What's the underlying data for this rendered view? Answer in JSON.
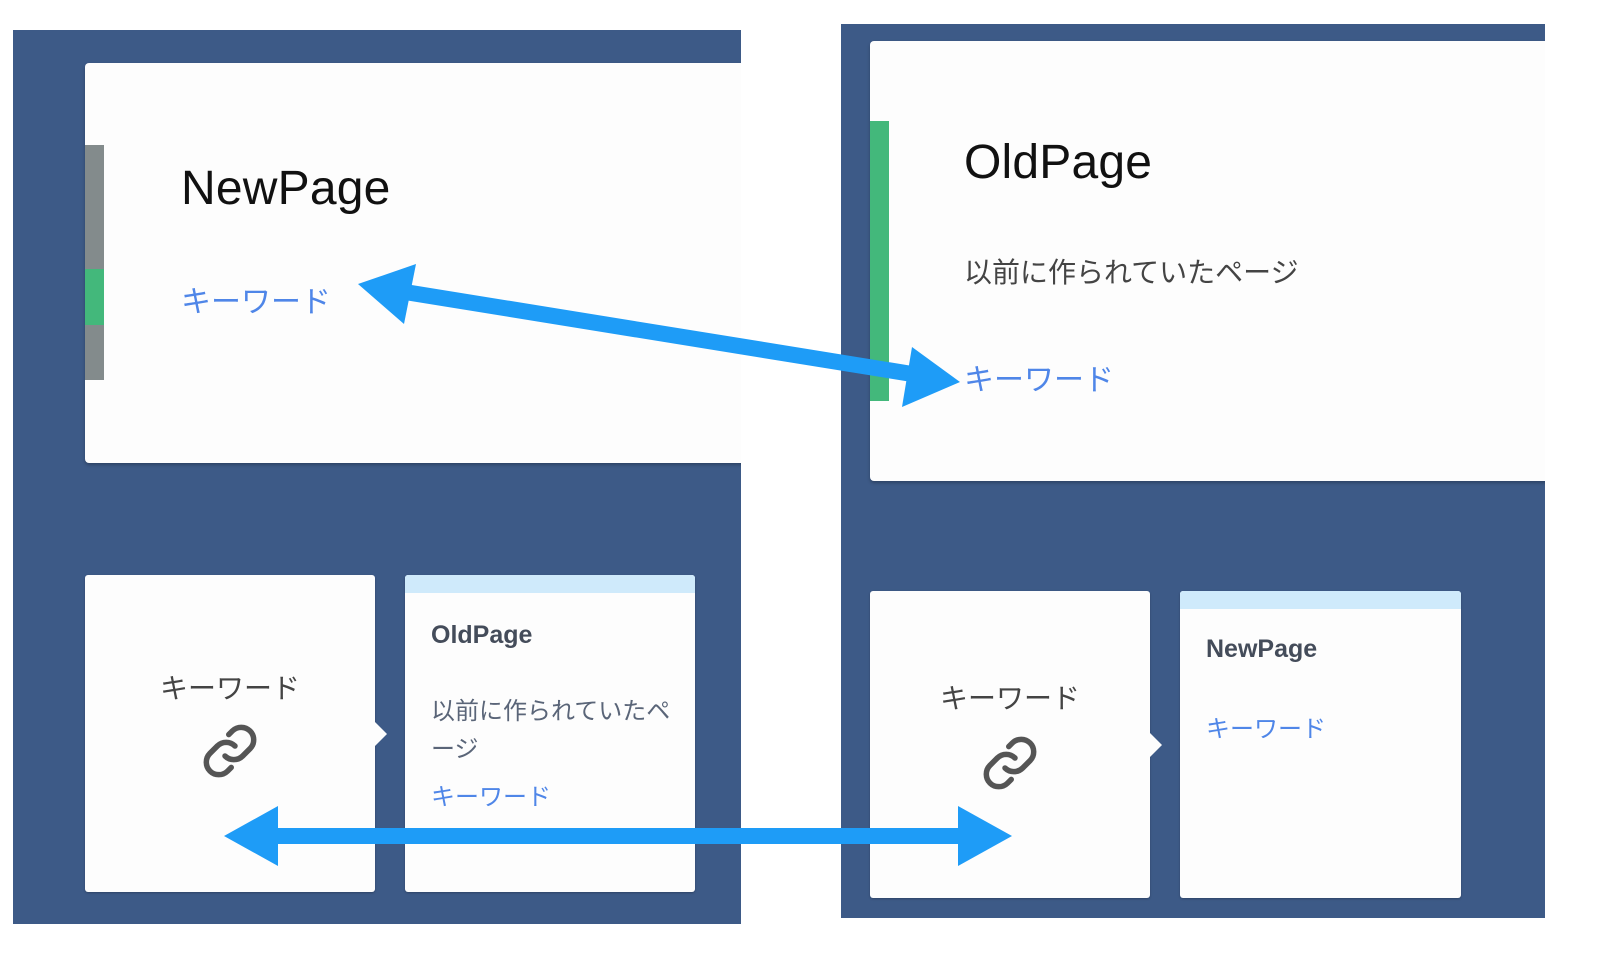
{
  "colors": {
    "panel_bg": "#3d5a87",
    "card_bg": "#fdfdfd",
    "keyword_link": "#4f86e8",
    "strip_green": "#43b87b",
    "strip_gray": "#838b8c",
    "card_topbar": "#cfeafb",
    "arrow": "#1e9cf7"
  },
  "left_panel": {
    "main_card": {
      "title": "NewPage",
      "keyword": "キーワード"
    },
    "link_card": {
      "keyword": "キーワード",
      "icon": "link-chain-icon"
    },
    "related_card": {
      "title": "OldPage",
      "description": "以前に作られていたページ",
      "keyword": "キーワード"
    }
  },
  "right_panel": {
    "main_card": {
      "title": "OldPage",
      "description": "以前に作られていたページ",
      "keyword": "キーワード"
    },
    "link_card": {
      "keyword": "キーワード",
      "icon": "link-chain-icon"
    },
    "related_card": {
      "title": "NewPage",
      "keyword": "キーワード"
    }
  },
  "arrows": [
    {
      "from": "NewPage keyword",
      "to": "OldPage keyword",
      "icon": "double-arrow-icon"
    },
    {
      "from": "left link card",
      "to": "right link card",
      "icon": "double-arrow-icon"
    }
  ]
}
